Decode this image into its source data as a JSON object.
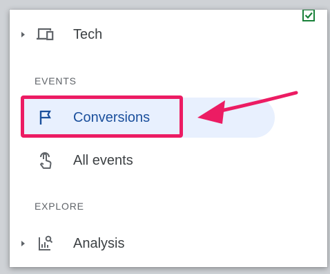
{
  "sidebar": {
    "tech_item": {
      "label": "Tech",
      "icon": "devices-icon"
    },
    "events_section": {
      "header": "EVENTS"
    },
    "conversions_item": {
      "label": "Conversions",
      "icon": "flag-icon",
      "active": true
    },
    "all_events_item": {
      "label": "All events",
      "icon": "touch-icon"
    },
    "explore_section": {
      "header": "EXPLORE"
    },
    "analysis_item": {
      "label": "Analysis",
      "icon": "analysis-icon"
    }
  },
  "annotation": {
    "highlight_color": "#ec1c63",
    "arrow_color": "#ec1c63"
  },
  "colors": {
    "active_background": "#e8f0fe",
    "active_text": "#1a4f9c",
    "text": "#3c4043",
    "muted": "#5f6368",
    "check_green": "#188038"
  }
}
